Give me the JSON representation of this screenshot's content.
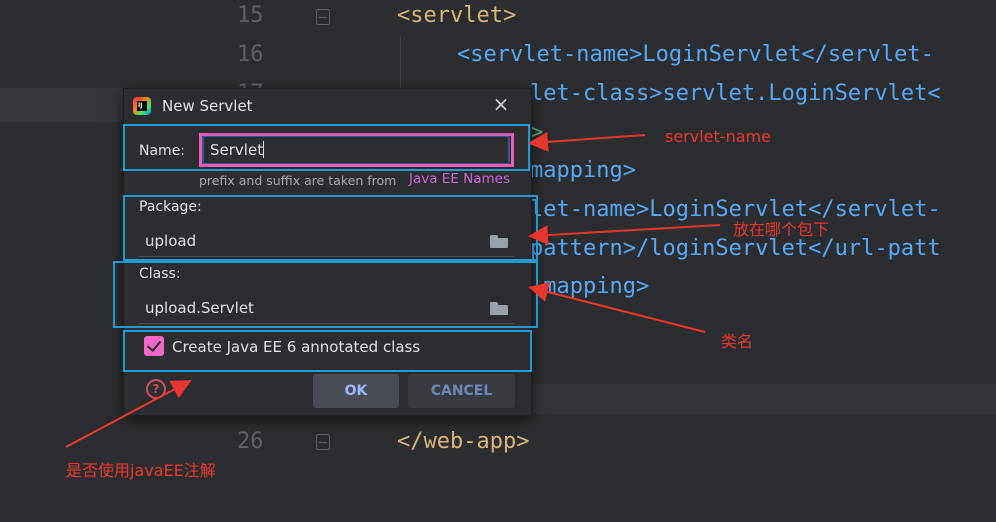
{
  "editor": {
    "lines": [
      {
        "number": "15",
        "text": "<servlet>"
      },
      {
        "number": "16",
        "text": "<servlet-name>LoginServlet</servlet-"
      },
      {
        "number": "17",
        "text": "let-class>servlet.LoginServlet<"
      },
      {
        "number": "",
        "text": ">"
      },
      {
        "number": "",
        "text": "mapping>"
      },
      {
        "number": "",
        "text": "let-name>LoginServlet</servlet-"
      },
      {
        "number": "",
        "text": "pattern>/loginServlet</url-patt"
      },
      {
        "number": "",
        "text": "-mapping>"
      },
      {
        "number": "26",
        "text": "</web-app>"
      }
    ]
  },
  "dialog": {
    "title": "New Servlet",
    "close_icon": "close-icon",
    "name_label": "Name:",
    "name_value": "Servlet",
    "hint": "prefix and suffix are taken from",
    "hint_link": "Java EE Names",
    "package_label": "Package:",
    "package_value": "upload",
    "class_label": "Class:",
    "class_value": "upload.Servlet",
    "checkbox_label": "Create Java EE 6 annotated class",
    "checkbox_checked": true,
    "help_icon": "?",
    "ok_label": "OK",
    "cancel_label": "CANCEL"
  },
  "annotations": {
    "servlet_name_note": "servlet-name",
    "package_note": "放在哪个包下",
    "class_note": "类名",
    "annotation_note": "是否使用javaEE注解",
    "arrow_color": "#e8362e",
    "box_color": "#1e9bd7",
    "highlight_color": "#e85cb8"
  }
}
